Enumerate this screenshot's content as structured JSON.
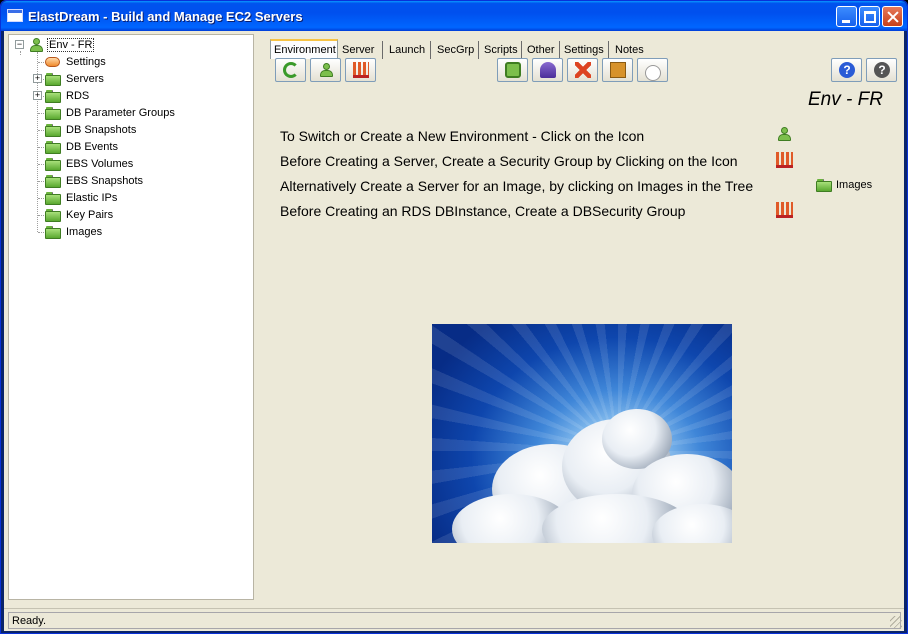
{
  "window": {
    "title": "ElastDream - Build and Manage EC2 Servers"
  },
  "tree": {
    "root": {
      "label": "Env - FR",
      "expander": "−"
    },
    "items": [
      {
        "label": "Settings",
        "icon": "settings-icon",
        "expander": ""
      },
      {
        "label": "Servers",
        "icon": "folder-icon",
        "expander": "+"
      },
      {
        "label": "RDS",
        "icon": "folder-icon",
        "expander": "+"
      },
      {
        "label": "DB Parameter Groups",
        "icon": "folder-icon",
        "expander": ""
      },
      {
        "label": "DB Snapshots",
        "icon": "folder-icon",
        "expander": ""
      },
      {
        "label": "DB Events",
        "icon": "folder-icon",
        "expander": ""
      },
      {
        "label": "EBS Volumes",
        "icon": "folder-icon",
        "expander": ""
      },
      {
        "label": "EBS Snapshots",
        "icon": "folder-icon",
        "expander": ""
      },
      {
        "label": "Elastic IPs",
        "icon": "folder-icon",
        "expander": ""
      },
      {
        "label": "Key Pairs",
        "icon": "folder-icon",
        "expander": ""
      },
      {
        "label": "Images",
        "icon": "folder-icon",
        "expander": ""
      }
    ]
  },
  "tabs": [
    "Environment",
    "Server",
    "Launch",
    "SecGrp",
    "Scripts",
    "Other",
    "Settings",
    "Notes"
  ],
  "active_tab": "Environment",
  "toolbar": {
    "left": [
      "refresh-icon",
      "user-icon",
      "security-group-icon"
    ],
    "middle": [
      "launch-icon",
      "user-manage-icon",
      "delete-icon",
      "book-icon",
      "cloud-icon"
    ],
    "right": [
      {
        "icon": "help-icon",
        "glyph": "?"
      },
      {
        "icon": "about-icon",
        "glyph": "?"
      }
    ]
  },
  "env_label": "Env - FR",
  "info_lines": [
    "To Switch or Create a New Environment - Click on the Icon",
    "Before Creating a Server, Create a Security Group by Clicking on the Icon",
    "Alternatively Create a Server for an Image, by clicking on Images in the Tree",
    "Before Creating an RDS DBInstance, Create a DBSecurity Group"
  ],
  "images_link": "Images",
  "status": "Ready."
}
